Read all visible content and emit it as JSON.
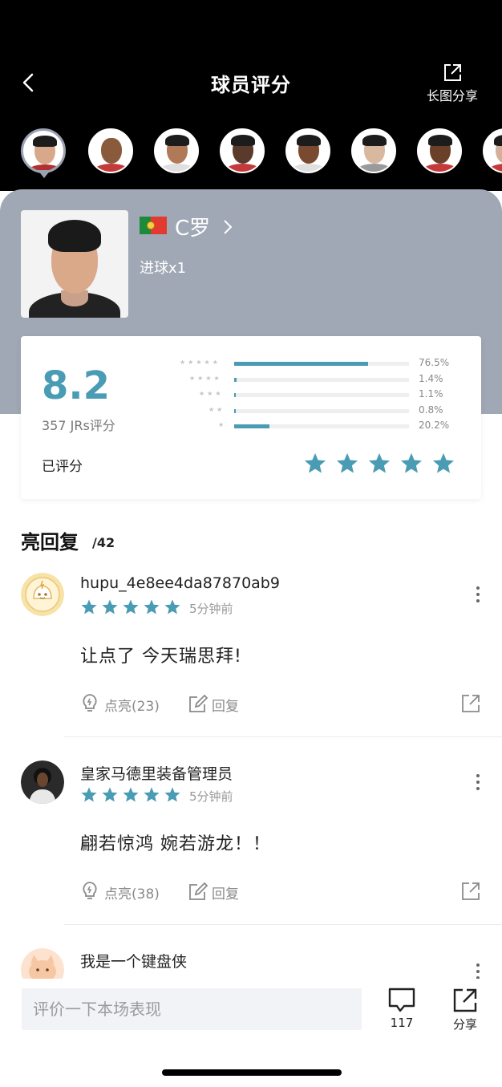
{
  "header": {
    "title": "球员评分",
    "share_label": "长图分享"
  },
  "players": [
    {
      "name": "C罗",
      "selected": true
    },
    {
      "selected": false
    },
    {
      "selected": false
    },
    {
      "selected": false
    },
    {
      "selected": false
    },
    {
      "selected": false
    },
    {
      "selected": false
    },
    {
      "selected": false
    }
  ],
  "player": {
    "name": "C罗",
    "country_flag": "portugal-flag",
    "stat": "进球x1"
  },
  "rating": {
    "score": "8.2",
    "count_label": "357 JRs评分",
    "rated_label": "已评分",
    "my_stars": 5,
    "distribution": [
      {
        "stars": 5,
        "percent": 76.5,
        "label": "76.5%"
      },
      {
        "stars": 4,
        "percent": 1.4,
        "label": "1.4%"
      },
      {
        "stars": 3,
        "percent": 1.1,
        "label": "1.1%"
      },
      {
        "stars": 2,
        "percent": 0.8,
        "label": "0.8%"
      },
      {
        "stars": 1,
        "percent": 20.2,
        "label": "20.2%"
      }
    ]
  },
  "comments_section": {
    "title": "亮回复",
    "count": "/42"
  },
  "comments": [
    {
      "user": "hupu_4e8ee4da87870ab9",
      "stars": 5,
      "time": "5分钟前",
      "text": "让点了 今天瑞思拜!",
      "light_label": "点亮(23)",
      "reply_label": "回复"
    },
    {
      "user": "皇家马德里装备管理员",
      "stars": 5,
      "time": "5分钟前",
      "text": "翩若惊鸿 婉若游龙！！",
      "light_label": "点亮(38)",
      "reply_label": "回复"
    },
    {
      "user": "我是一个键盘侠"
    }
  ],
  "bottom_bar": {
    "input_placeholder": "评价一下本场表现",
    "comment_count": "117",
    "share_label": "分享"
  },
  "colors": {
    "accent": "#4a9cb4",
    "card_bg": "#a0a7b5",
    "header_bg": "#000000"
  }
}
